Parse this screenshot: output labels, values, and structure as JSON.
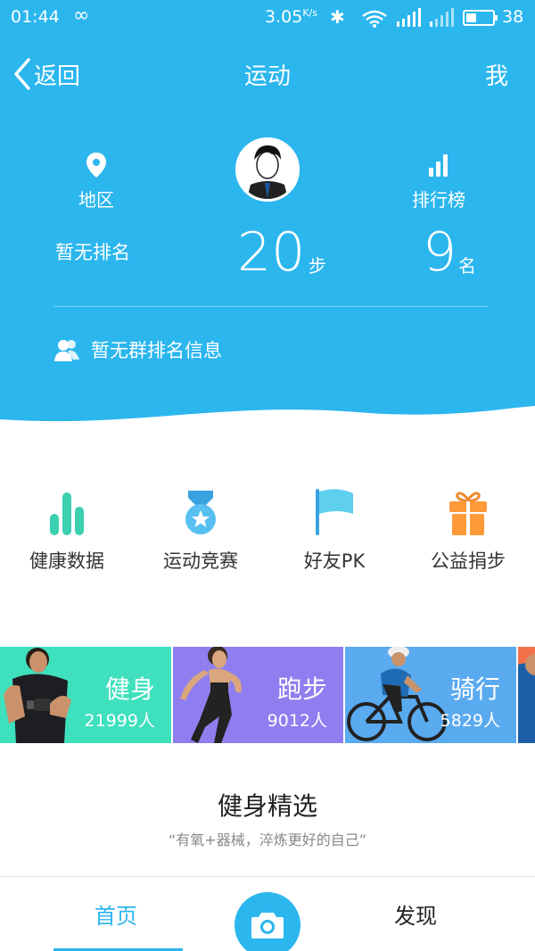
{
  "status_bar": {
    "time": "01:44",
    "loop_icon": "∞",
    "net_speed": "3.05",
    "net_unit": "K/s",
    "bluetooth_icon": "bluetooth-icon",
    "battery": "38",
    "battery_level": 0.38
  },
  "nav": {
    "back_label": "返回",
    "title": "运动",
    "me_label": "我"
  },
  "summary": {
    "region_label": "地区",
    "leaderboard_label": "排行榜",
    "region_rank_text": "暂无排名",
    "steps_value": "20",
    "steps_unit": "步",
    "rank_value": "9",
    "rank_unit": "名",
    "group_info": "暂无群排名信息"
  },
  "functions": [
    {
      "label": "健康数据",
      "icon": "bar-chart-icon",
      "color": "#3ccfb0"
    },
    {
      "label": "运动竞赛",
      "icon": "medal-icon",
      "color": "#45b5ee"
    },
    {
      "label": "好友PK",
      "icon": "flag-icon",
      "color": "#58c8ee"
    },
    {
      "label": "公益捐步",
      "icon": "gift-icon",
      "color": "#ff8f2e"
    }
  ],
  "sports": [
    {
      "name": "健身",
      "count": "21999人",
      "color": "#3fe0be"
    },
    {
      "name": "跑步",
      "count": "9012人",
      "color": "#8e7ef0"
    },
    {
      "name": "骑行",
      "count": "5829人",
      "color": "#5aaaf0"
    },
    {
      "name": "",
      "count": "",
      "color": "#f4704a"
    }
  ],
  "section": {
    "title": "健身精选",
    "subtitle": "“有氧+器械，淬炼更好的自己”"
  },
  "tabbar": {
    "home_label": "首页",
    "discover_label": "发现",
    "camera_icon": "camera-icon"
  }
}
